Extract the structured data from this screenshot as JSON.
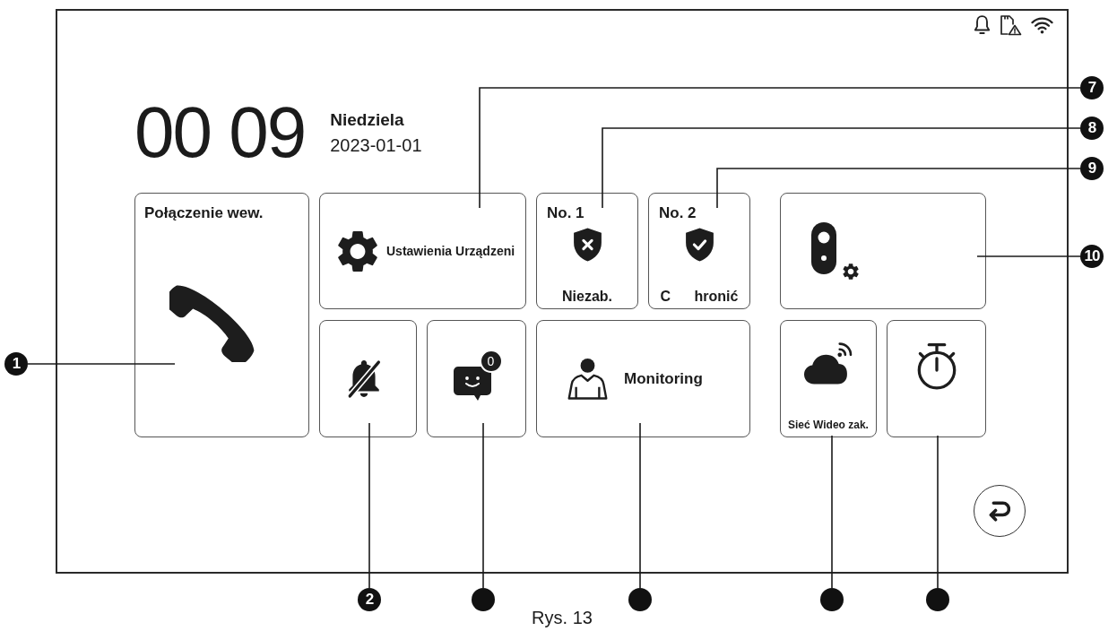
{
  "clock": {
    "time": "00 09",
    "day": "Niedziela",
    "date": "2023-01-01"
  },
  "tiles": [
    {
      "kind": "call",
      "label": "Połączenie wew."
    },
    {
      "kind": "settings",
      "label": "Ustawienia Urządzeni"
    },
    {
      "kind": "zone",
      "title": "No. 1",
      "status": "Niezab.",
      "armed": false
    },
    {
      "kind": "zone",
      "title": "No. 2",
      "status": "C hronić",
      "armed": true
    },
    {
      "kind": "doorbell"
    },
    {
      "kind": "mute"
    },
    {
      "kind": "messages",
      "badge": "0"
    },
    {
      "kind": "monitoring",
      "label": "Monitoring"
    },
    {
      "kind": "cloud",
      "label": "Sieć Wideo zak."
    },
    {
      "kind": "timer"
    }
  ],
  "callouts": [
    {
      "kind": "numbered",
      "number": "7"
    },
    {
      "kind": "numbered",
      "number": "8"
    },
    {
      "kind": "numbered",
      "number": "9"
    },
    {
      "kind": "numbered",
      "number": "10"
    },
    {
      "kind": "numbered",
      "number": "1"
    },
    {
      "kind": "numbered",
      "number": "2"
    },
    {
      "kind": "blank"
    },
    {
      "kind": "blank"
    },
    {
      "kind": "blank"
    },
    {
      "kind": "blank"
    }
  ],
  "caption": "Rys. 13"
}
